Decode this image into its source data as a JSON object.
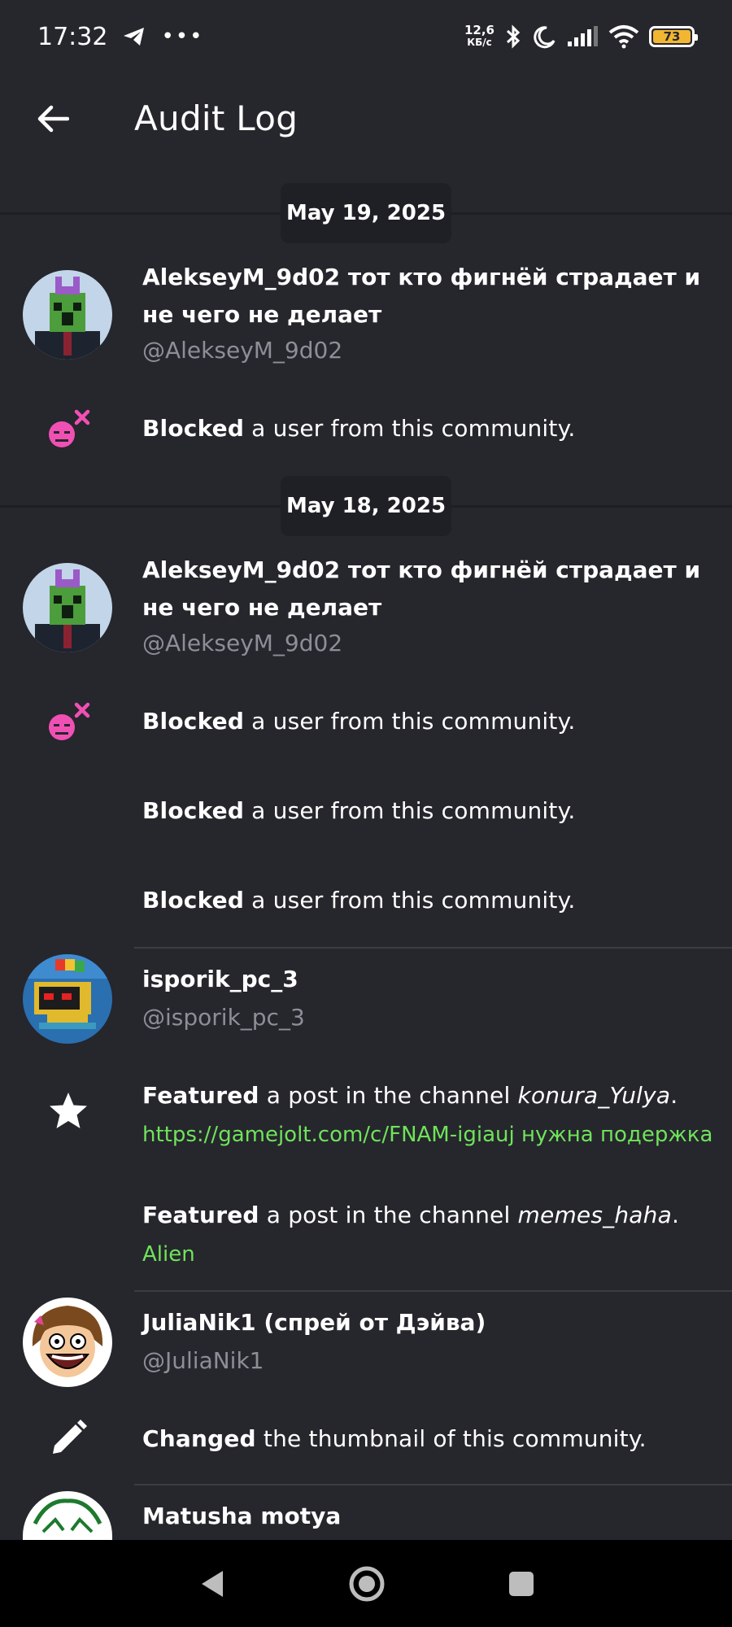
{
  "status": {
    "time": "17:32",
    "net_speed_value": "12,6",
    "net_speed_unit": "КБ/с",
    "battery": "73"
  },
  "header": {
    "title": "Audit Log"
  },
  "groups": [
    {
      "date": "May 19, 2025",
      "user": {
        "name": "AlekseyM_9d02 тот кто фигнёй страдает и не чего не делает",
        "handle": "@AlekseyM_9d02"
      },
      "actions": [
        {
          "verb": "Blocked",
          "text": " a user from this community."
        }
      ]
    },
    {
      "date": "May 18, 2025",
      "user": {
        "name": "AlekseyM_9d02 тот кто фигнёй страдает и не чего не делает",
        "handle": "@AlekseyM_9d02"
      },
      "actions": [
        {
          "verb": "Blocked",
          "text": " a user from this community."
        },
        {
          "verb": "Blocked",
          "text": " a user from this community."
        },
        {
          "verb": "Blocked",
          "text": " a user from this community."
        }
      ]
    }
  ],
  "isporik": {
    "name": "isporik_pc_3",
    "handle": "@isporik_pc_3",
    "actions": [
      {
        "verb": "Featured",
        "text": " a post in the channel ",
        "channel": "konura_Yulya",
        "end": ".",
        "link": "https://gamejolt.com/c/FNAM-igiauj нужна подержка"
      },
      {
        "verb": "Featured",
        "text": " a post in the channel ",
        "channel": "memes_haha",
        "end": ".",
        "link": "Alien"
      }
    ]
  },
  "julia": {
    "name": "JuliaNik1 (спрей от Дэйва)",
    "handle": "@JuliaNik1",
    "actions": [
      {
        "verb": "Changed",
        "text": " the thumbnail of this community."
      }
    ]
  },
  "matusha": {
    "name": "Matusha motya"
  },
  "colors": {
    "background": "#26262d",
    "link": "#6fe35a",
    "handle": "#8e8e99",
    "block_icon": "#f050b4"
  },
  "icons": {
    "back": "arrow-left-icon",
    "block": "block-user-icon",
    "star": "star-icon",
    "edit": "pencil-icon"
  }
}
